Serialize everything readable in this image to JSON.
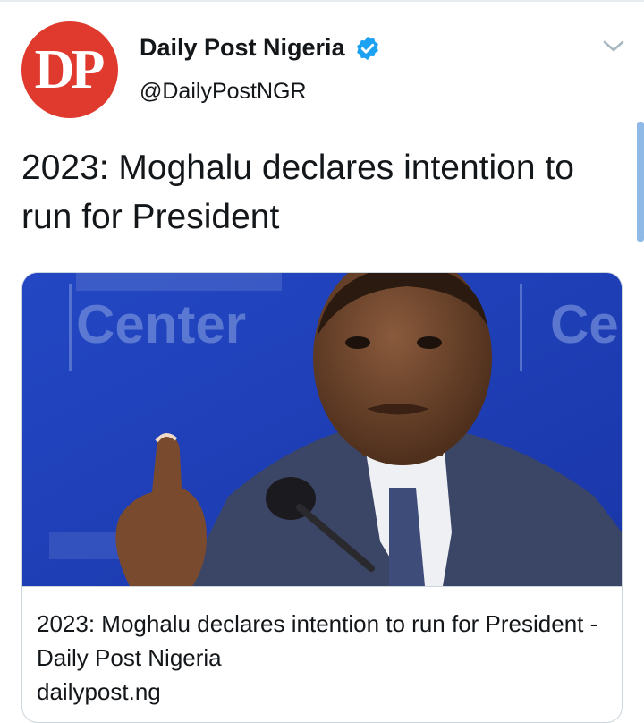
{
  "author": {
    "display_name": "Daily Post Nigeria",
    "handle": "@DailyPostNGR",
    "avatar_initials": "DP",
    "avatar_color": "#e03a2f",
    "verified": true,
    "verified_icon": "verified-badge-icon"
  },
  "tweet": {
    "text": "2023: Moghalu declares intention to run for President"
  },
  "link_card": {
    "image_description": "photo",
    "backdrop_text_left": "Center",
    "backdrop_text_right": "Ce",
    "title": "2023: Moghalu declares intention to run for President - Daily Post Nigeria",
    "domain": "dailypost.ng"
  },
  "colors": {
    "accent": "#1da1f2",
    "text": "#14171a",
    "border": "#ccd6dd"
  }
}
